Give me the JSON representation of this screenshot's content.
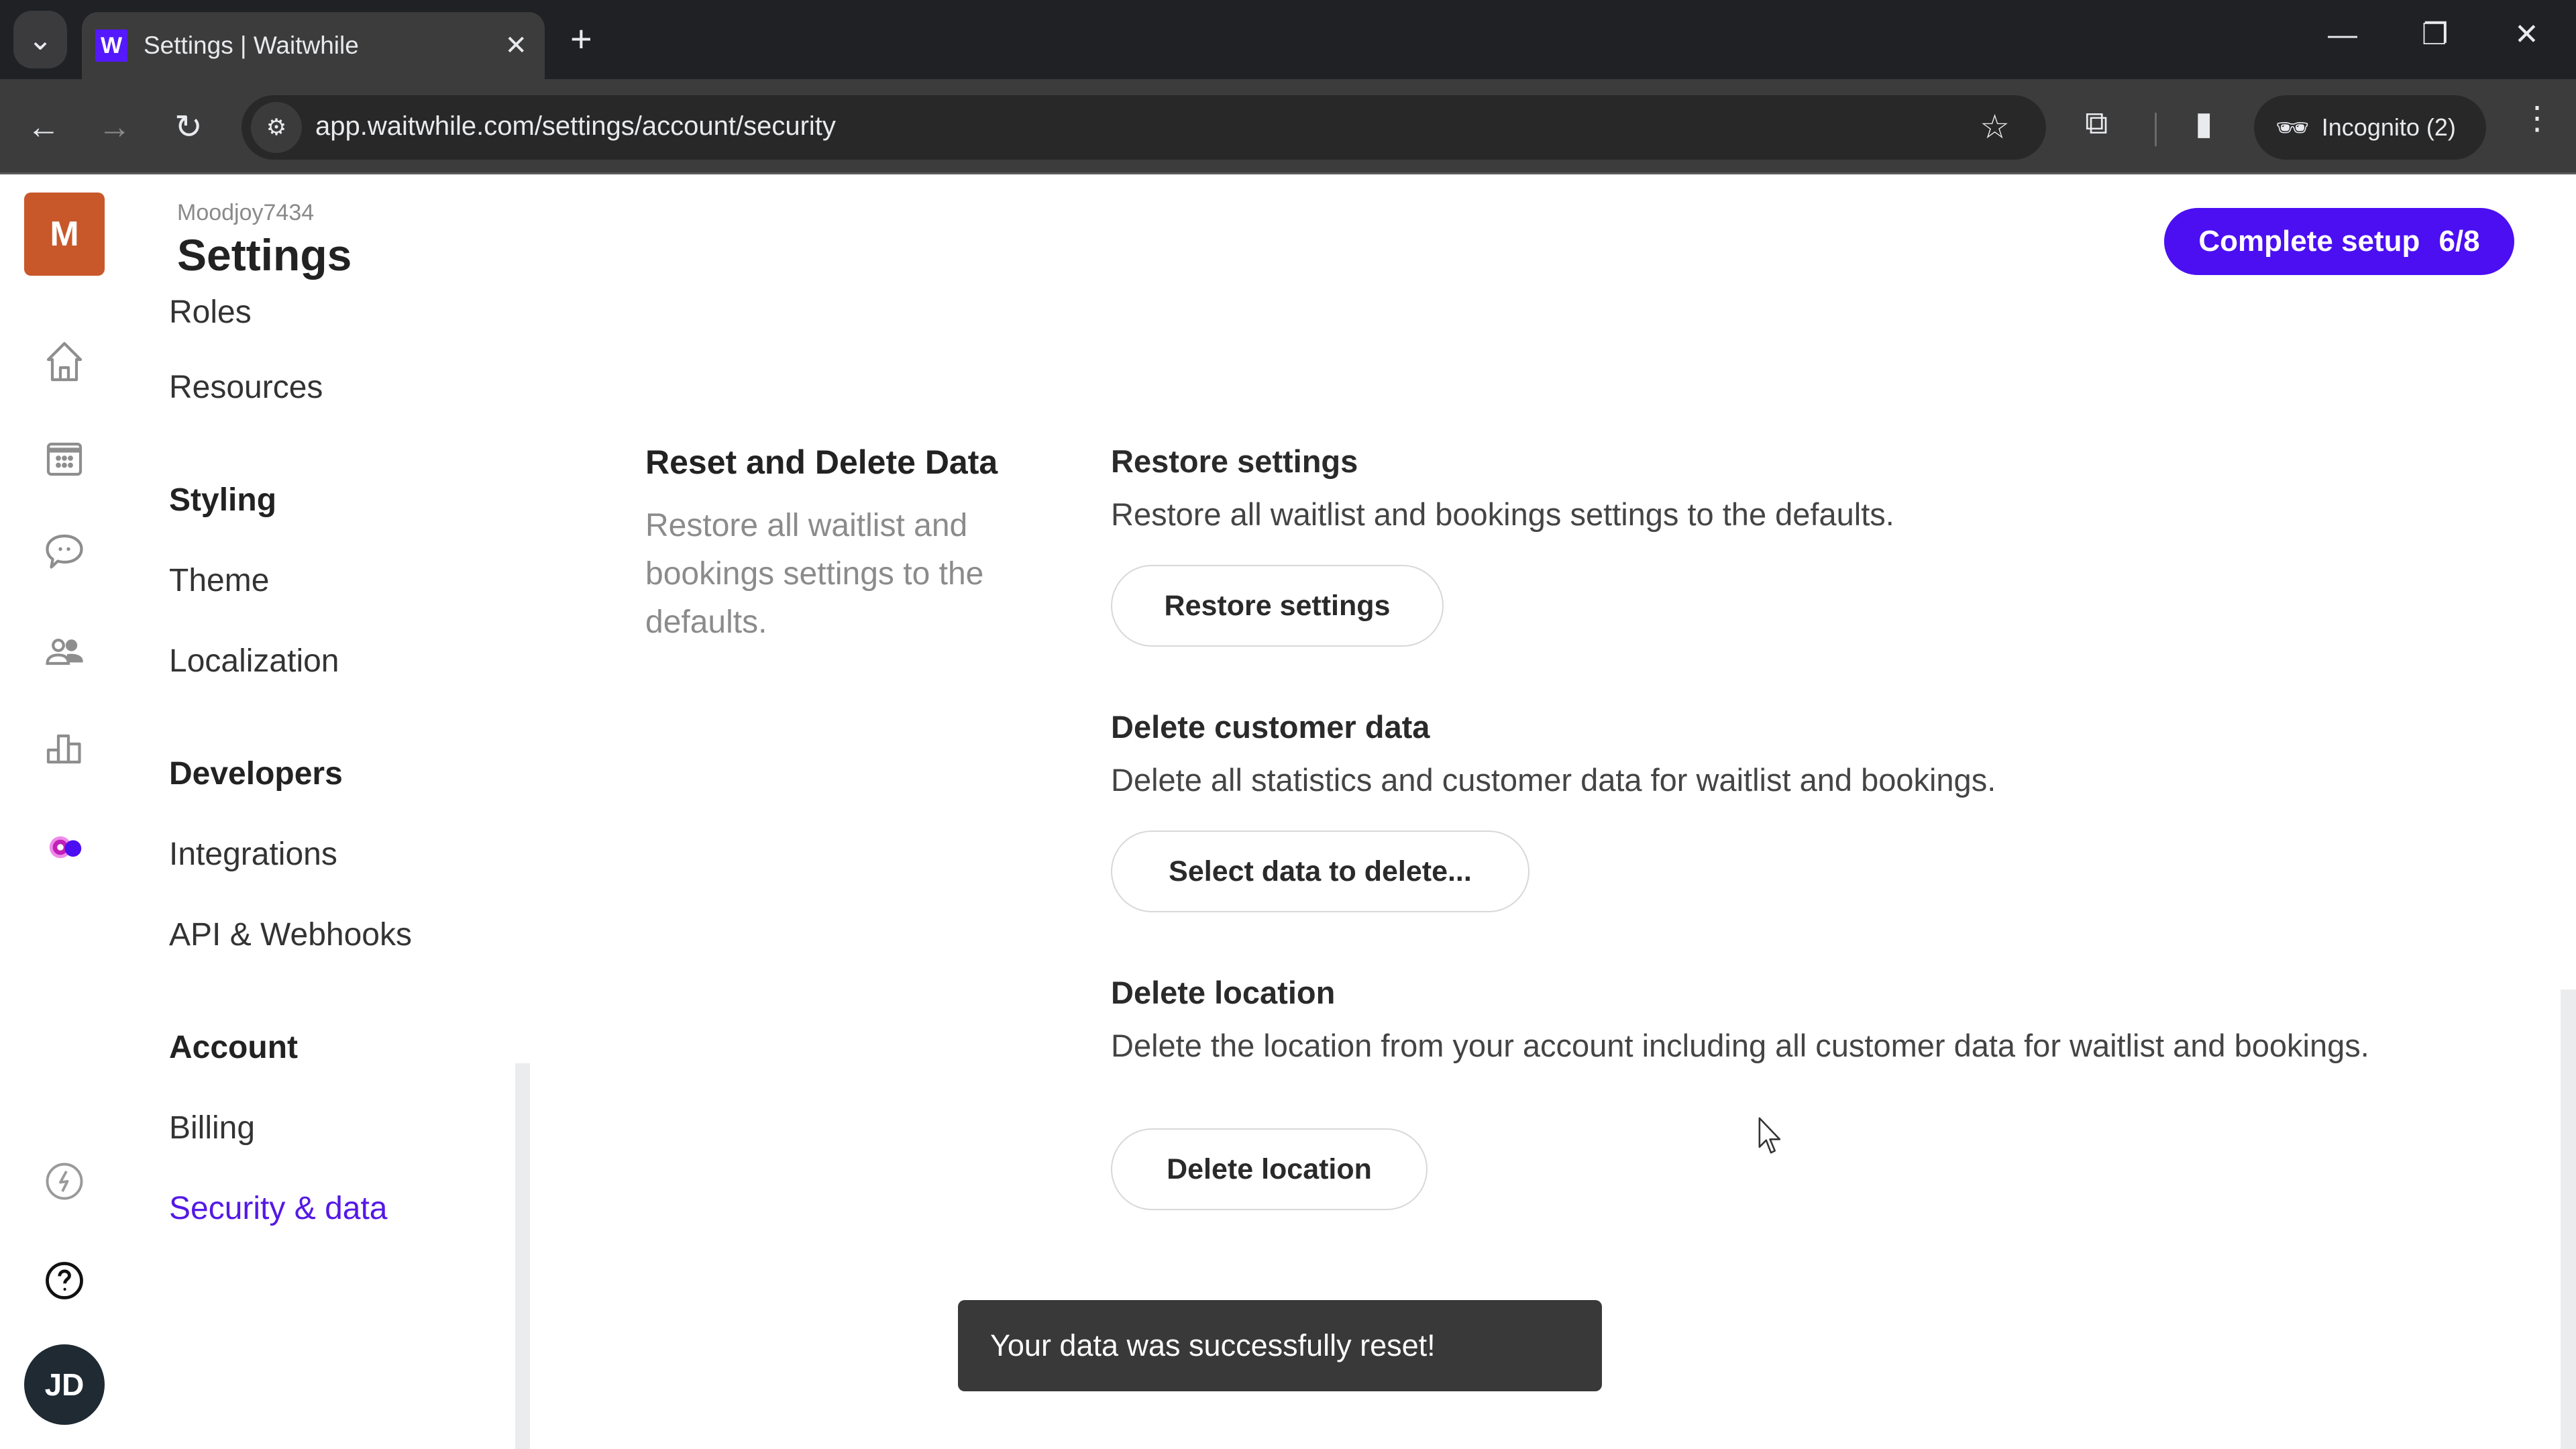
{
  "browser": {
    "tab_title": "Settings | Waitwhile",
    "favicon_letter": "W",
    "url": "app.waitwhile.com/settings/account/security",
    "incognito_label": "Incognito (2)",
    "icons": {
      "tab_search": "chevron-down-icon",
      "close_tab": "close-icon",
      "new_tab": "plus-icon",
      "minimize": "minimize-icon",
      "restore": "restore-icon",
      "close_window": "close-icon",
      "back": "back-arrow-icon",
      "forward": "forward-arrow-icon",
      "reload": "reload-icon",
      "site_info": "tune-icon",
      "bookmark": "star-icon",
      "extensions": "puzzle-icon",
      "side_panel": "side-panel-icon",
      "incognito": "incognito-icon",
      "menu": "kebab-menu-icon"
    },
    "glyphs": {
      "tab_search": "⌄",
      "close_tab": "✕",
      "new_tab": "+",
      "minimize": "—",
      "restore": "❐",
      "close_window": "✕",
      "back": "←",
      "forward": "→",
      "reload": "↻",
      "site_info": "⚙",
      "bookmark": "☆",
      "extensions": "⧉",
      "side_panel": "▮",
      "incognito": "🕶",
      "menu": "⋮"
    }
  },
  "rail": {
    "location_avatar": "M",
    "user_avatar": "JD",
    "items": [
      {
        "name": "home",
        "icon": "home-icon"
      },
      {
        "name": "calendar",
        "icon": "calendar-icon"
      },
      {
        "name": "messages",
        "icon": "chat-bubble-icon"
      },
      {
        "name": "customers",
        "icon": "users-icon"
      },
      {
        "name": "analytics",
        "icon": "bar-chart-icon"
      },
      {
        "name": "settings",
        "icon": "settings-toggle-icon",
        "active": true
      },
      {
        "name": "whats-new",
        "icon": "lightning-icon"
      },
      {
        "name": "help",
        "icon": "help-circle-icon"
      }
    ],
    "colors": {
      "location_avatar": "#c8582a",
      "user_avatar": "#1f2a33",
      "active_gear": "#c21fb8",
      "active_dot": "#4b0ff2"
    }
  },
  "header": {
    "org_name": "Moodjoy7434",
    "title": "Settings",
    "setup_button": {
      "label": "Complete setup",
      "progress": "6/8",
      "completed": 6,
      "total": 8,
      "color": "#4b0ff2"
    }
  },
  "settings_nav": {
    "items": [
      {
        "type": "item",
        "label": "Roles"
      },
      {
        "type": "item",
        "label": "Resources"
      },
      {
        "type": "heading",
        "label": "Styling"
      },
      {
        "type": "item",
        "label": "Theme"
      },
      {
        "type": "item",
        "label": "Localization"
      },
      {
        "type": "heading",
        "label": "Developers"
      },
      {
        "type": "item",
        "label": "Integrations"
      },
      {
        "type": "item",
        "label": "API & Webhooks"
      },
      {
        "type": "heading",
        "label": "Account"
      },
      {
        "type": "item",
        "label": "Billing"
      },
      {
        "type": "item",
        "label": "Security & data",
        "active": true
      }
    ],
    "active_color": "#5419e6"
  },
  "main": {
    "section": {
      "title": "Reset and Delete Data",
      "description": "Restore all waitlist and bookings settings to the defaults."
    },
    "blocks": [
      {
        "title": "Restore settings",
        "description": "Restore all waitlist and bookings settings to the defaults.",
        "button": "Restore settings"
      },
      {
        "title": "Delete customer data",
        "description": "Delete all statistics and customer data for waitlist and bookings.",
        "button": "Select data to delete..."
      },
      {
        "title": "Delete location",
        "description": "Delete the location from your account including all customer data for waitlist and bookings.",
        "button": "Delete location"
      }
    ]
  },
  "toast": {
    "message": "Your data was successfully reset!"
  }
}
